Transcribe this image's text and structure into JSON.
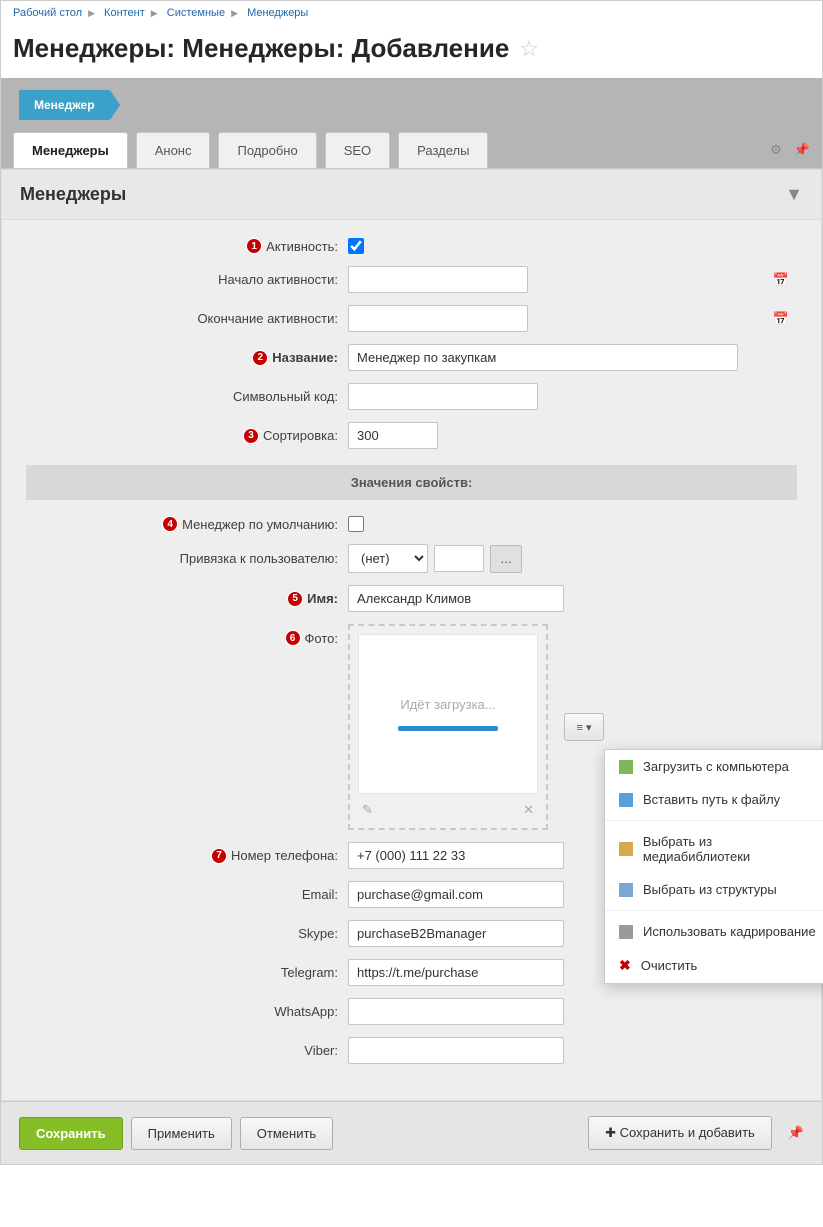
{
  "breadcrumb": [
    "Рабочий стол",
    "Контент",
    "Системные",
    "Менеджеры"
  ],
  "page_title": "Менеджеры: Менеджеры: Добавление",
  "ribbon": "Менеджер",
  "tabs": [
    "Менеджеры",
    "Анонс",
    "Подробно",
    "SEO",
    "Разделы"
  ],
  "panel_title": "Менеджеры",
  "labels": {
    "active": "Активность:",
    "start": "Начало активности:",
    "end": "Окончание активности:",
    "name": "Название:",
    "code": "Символьный код:",
    "sort": "Сортировка:",
    "props": "Значения свойств:",
    "default_mgr": "Менеджер по умолчанию:",
    "user_bind": "Привязка к пользователю:",
    "iname": "Имя:",
    "photo": "Фото:",
    "phone": "Номер телефона:",
    "email": "Email:",
    "skype": "Skype:",
    "telegram": "Telegram:",
    "whatsapp": "WhatsApp:",
    "viber": "Viber:"
  },
  "values": {
    "name": "Менеджер по закупкам",
    "sort": "300",
    "user_sel": "(нет)",
    "iname": "Александр Климов",
    "phone": "+7 (000) 111 22 33",
    "email": "purchase@gmail.com",
    "skype": "purchaseB2Bmanager",
    "telegram": "https://t.me/purchase",
    "whatsapp": "",
    "viber": "",
    "loading": "Идёт загрузка..."
  },
  "badges": {
    "b1": "1",
    "b2": "2",
    "b3": "3",
    "b4": "4",
    "b5": "5",
    "b6": "6",
    "b7": "7"
  },
  "dots_btn": "...",
  "menu": {
    "upload": "Загрузить с компьютера",
    "path": "Вставить путь к файлу",
    "media": "Выбрать из медиабиблиотеки",
    "struct": "Выбрать из структуры",
    "crop": "Использовать кадрирование",
    "clear": "Очистить"
  },
  "buttons": {
    "save": "Сохранить",
    "apply": "Применить",
    "cancel": "Отменить",
    "save_add": "Сохранить и добавить"
  }
}
